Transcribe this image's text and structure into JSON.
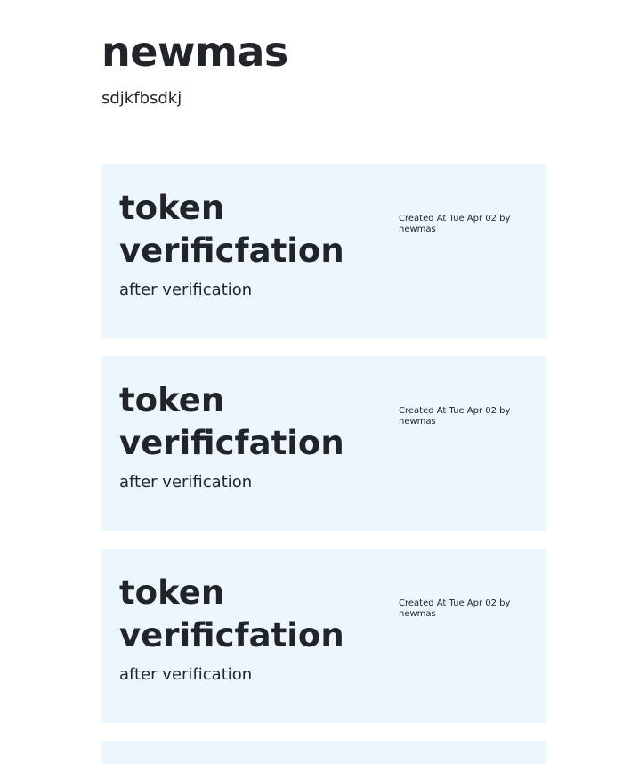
{
  "header": {
    "title": "newmas",
    "subtitle": "sdjkfbsdkj"
  },
  "posts": [
    {
      "title": "token verificfation",
      "body": "after verification",
      "meta": "Created At Tue Apr 02 by newmas"
    },
    {
      "title": "token verificfation",
      "body": "after verification",
      "meta": "Created At Tue Apr 02 by newmas"
    },
    {
      "title": "token verificfation",
      "body": "after verification",
      "meta": "Created At Tue Apr 02 by newmas"
    }
  ],
  "colors": {
    "card_background": "#eef6fd",
    "text": "#212529"
  }
}
